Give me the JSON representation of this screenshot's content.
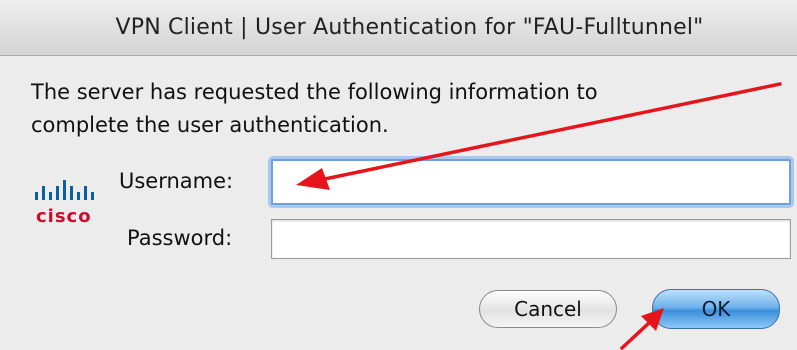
{
  "dialog": {
    "title": "VPN Client  |  User Authentication for \"FAU-Fulltunnel\"",
    "message_line1": "The server has requested the following information to",
    "message_line2": "complete the user authentication.",
    "logo_text": "cisco"
  },
  "form": {
    "username_label": "Username:",
    "username_value": "",
    "password_label": "Password:",
    "password_value": ""
  },
  "buttons": {
    "cancel_label": "Cancel",
    "ok_label": "OK"
  },
  "colors": {
    "annotation_arrow": "#e8141b",
    "focus_ring": "#6fa0d8",
    "ok_button": "#4a9be3",
    "cisco_red": "#c8102e"
  }
}
